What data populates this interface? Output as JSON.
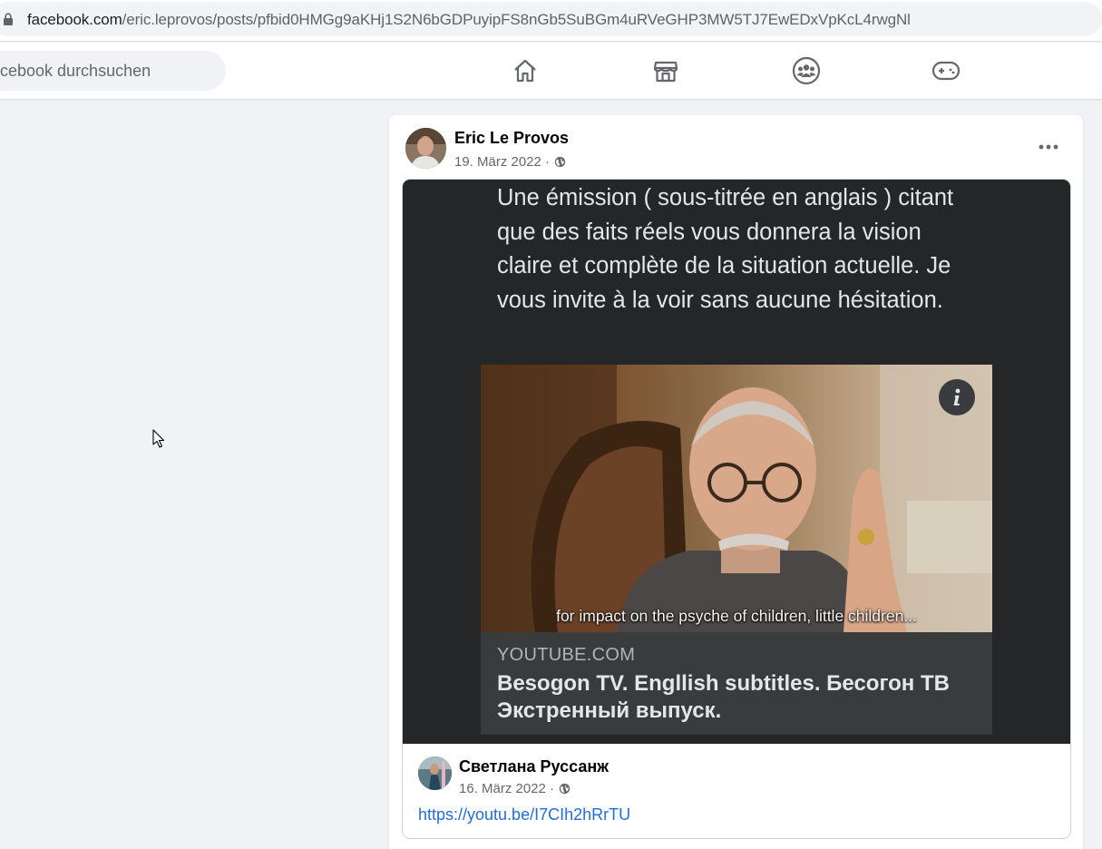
{
  "browser": {
    "url_domain": "facebook.com",
    "url_path": "/eric.leprovos/posts/pfbid0HMGg9aKHj1S2N6bGDPuyipFS8nGb5SuBGm4uRVeGHP3MW5TJ7EwEDxVpKcL4rwgNl"
  },
  "header": {
    "search_placeholder": "cebook durchsuchen",
    "nav": [
      "home-icon",
      "marketplace-icon",
      "groups-icon",
      "gaming-icon"
    ]
  },
  "post": {
    "author": "Eric Le Provos",
    "date": "19. März 2022 ·",
    "audience_icon": "globe-icon",
    "more_icon": "more-options-icon"
  },
  "shared": {
    "text": "Une émission ( sous-titrée en anglais ) citant que des faits réels vous donnera la vision claire et complète de la situation actuelle. Je vous invite à la voir sans aucune hésitation.",
    "video_subtitle": "for impact on the psyche of children, little children...",
    "link_domain": "YOUTUBE.COM",
    "link_title": "Besogon TV. Engllish subtitles. Бесогон ТВ Экстренный выпуск.",
    "original_author": "Светлана Руссанж",
    "original_date": "16. März 2022 ·",
    "original_link": "https://youtu.be/I7CIh2hRrTU"
  },
  "colors": {
    "link": "#216fdb",
    "dark_bg": "#252627",
    "page_bg": "#f0f2f5"
  }
}
